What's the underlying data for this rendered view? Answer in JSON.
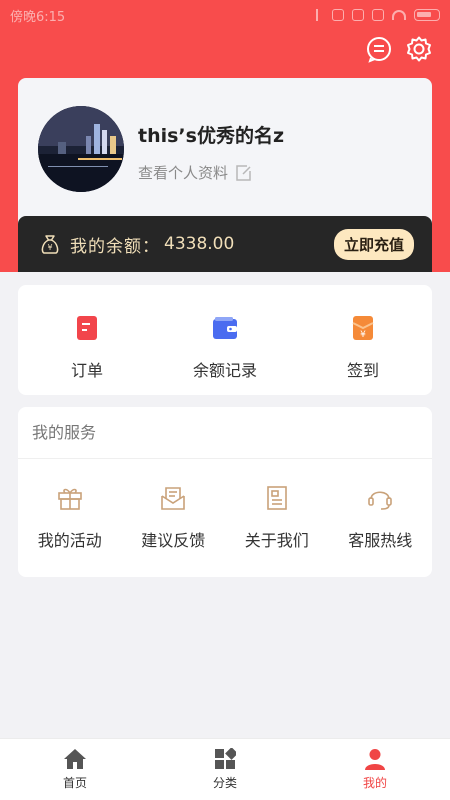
{
  "status_bar": {
    "time": "傍晚6:15"
  },
  "profile": {
    "name": "this’s优秀的名z",
    "view_profile_label": "查看个人资料"
  },
  "balance": {
    "label": "我的余额：",
    "amount": "4338.00",
    "recharge_label": "立即充值"
  },
  "quick_actions": [
    {
      "label": "订单",
      "icon": "order-icon"
    },
    {
      "label": "余额记录",
      "icon": "wallet-icon"
    },
    {
      "label": "签到",
      "icon": "checkin-icon"
    }
  ],
  "services": {
    "title": "我的服务",
    "items": [
      {
        "label": "我的活动",
        "icon": "gift-icon"
      },
      {
        "label": "建议反馈",
        "icon": "mail-icon"
      },
      {
        "label": "关于我们",
        "icon": "document-icon"
      },
      {
        "label": "客服热线",
        "icon": "headset-icon"
      }
    ]
  },
  "tabbar": {
    "items": [
      {
        "label": "首页",
        "icon": "home-icon"
      },
      {
        "label": "分类",
        "icon": "category-icon"
      },
      {
        "label": "我的",
        "icon": "user-icon",
        "active": true
      }
    ]
  },
  "colors": {
    "header_red": "#f84c4c",
    "balance_bg": "#262626",
    "balance_text": "#f1dfb9",
    "active_tab": "#f04545"
  }
}
